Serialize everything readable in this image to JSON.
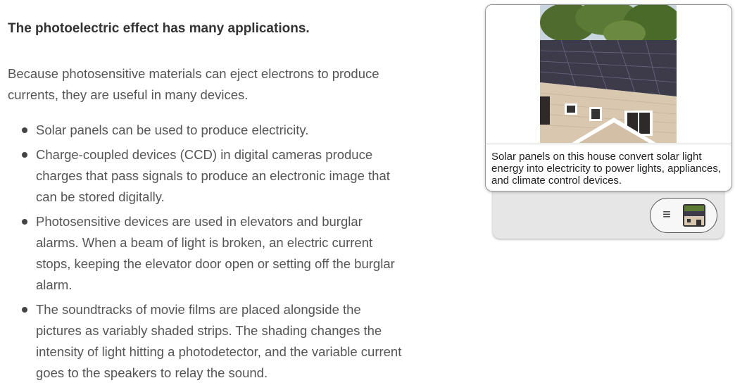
{
  "article": {
    "heading": "The photoelectric effect has many applications.",
    "intro": "Because photosensitive materials can eject electrons to produce currents, they are useful in many devices.",
    "bullets": [
      "Solar panels can be used to produce electricity.",
      "Charge-coupled devices (CCD) in digital cameras produce charges that pass signals to produce an electronic image that can be stored digitally.",
      "Photosensitive devices are used in elevators and burglar alarms. When a beam of light is broken, an electric current stops, keeping the elevator door open or setting off the burglar alarm.",
      "The soundtracks of movie films are placed alongside the pictures as variably shaded strips. The shading changes the intensity of light hitting a photodetector, and the variable current goes to the speakers to relay the sound."
    ]
  },
  "figure": {
    "caption": "Solar panels on this house convert solar light energy into electricity to power lights, appliances, and climate control devices.",
    "menu_icon": "hamburger-menu-icon",
    "thumbnail_icon": "image-thumbnail-icon"
  },
  "colors": {
    "text": "#555555",
    "heading": "#333333",
    "widget_background": "#e6e6e6"
  }
}
